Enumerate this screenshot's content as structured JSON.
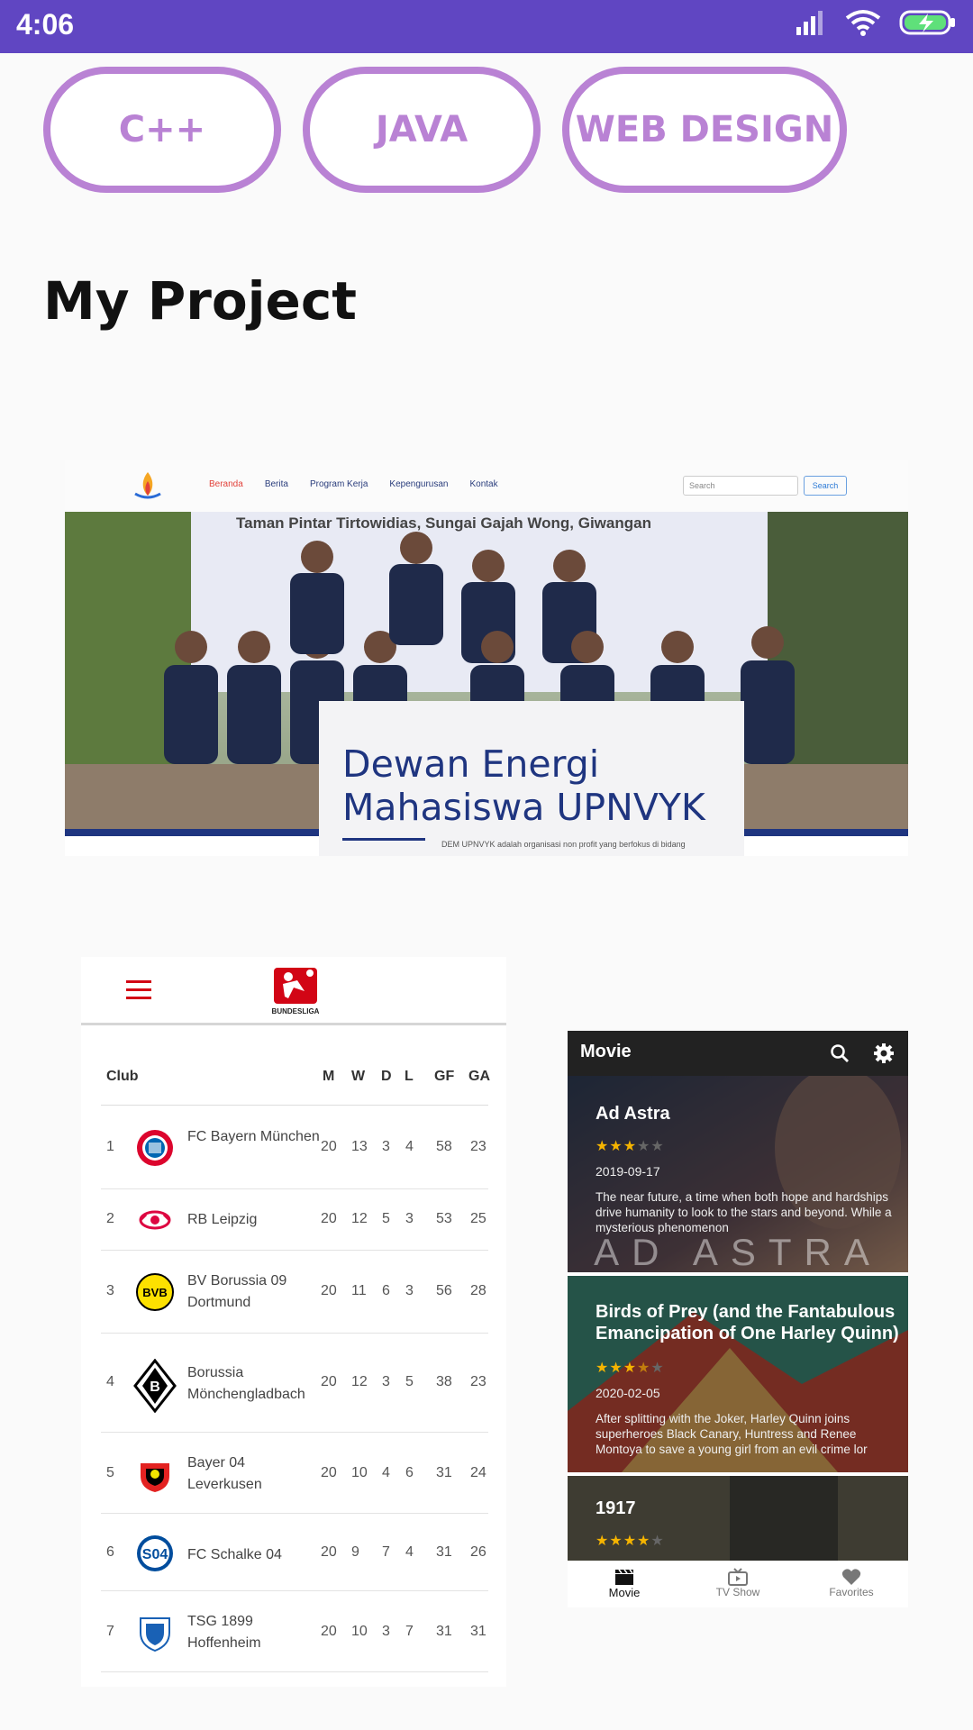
{
  "status_bar": {
    "time": "4:06"
  },
  "skills": [
    "C++",
    "JAVA",
    "WEB DESIGN"
  ],
  "section_title": "My Project",
  "website_project": {
    "nav_links": [
      "Beranda",
      "Berita",
      "Program Kerja",
      "Kepengurusan",
      "Kontak"
    ],
    "search_placeholder": "Search",
    "search_button": "Search",
    "banner_text": "Taman Pintar Tirtowidias, Sungai Gajah Wong, Giwangan",
    "card_title": "Dewan Energi Mahasiswa UPNVYK",
    "card_desc": "DEM UPNVYK adalah organisasi non profit yang berfokus di bidang"
  },
  "bundesliga_project": {
    "logo_text": "BUNDESLIGA",
    "headers": [
      "Club",
      "M",
      "W",
      "D",
      "L",
      "GF",
      "GA"
    ],
    "rows": [
      {
        "rank": "1",
        "club": "FC Bayern München",
        "m": "20",
        "w": "13",
        "d": "3",
        "l": "4",
        "gf": "58",
        "ga": "23"
      },
      {
        "rank": "2",
        "club": "RB Leipzig",
        "m": "20",
        "w": "12",
        "d": "5",
        "l": "3",
        "gf": "53",
        "ga": "25"
      },
      {
        "rank": "3",
        "club": "BV Borussia 09 Dortmund",
        "m": "20",
        "w": "11",
        "d": "6",
        "l": "3",
        "gf": "56",
        "ga": "28"
      },
      {
        "rank": "4",
        "club": "Borussia Mönchengladbach",
        "m": "20",
        "w": "12",
        "d": "3",
        "l": "5",
        "gf": "38",
        "ga": "23"
      },
      {
        "rank": "5",
        "club": "Bayer 04 Leverkusen",
        "m": "20",
        "w": "10",
        "d": "4",
        "l": "6",
        "gf": "31",
        "ga": "24"
      },
      {
        "rank": "6",
        "club": "FC Schalke 04",
        "m": "20",
        "w": "9",
        "d": "7",
        "l": "4",
        "gf": "31",
        "ga": "26"
      },
      {
        "rank": "7",
        "club": "TSG 1899 Hoffenheim",
        "m": "20",
        "w": "10",
        "d": "3",
        "l": "7",
        "gf": "31",
        "ga": "31"
      }
    ]
  },
  "movie_project": {
    "app_title": "Movie",
    "movies": [
      {
        "title": "Ad Astra",
        "rating_stars": 3,
        "date": "2019-09-17",
        "desc": "The near future, a time when both hope and hardships drive humanity to look to the stars and beyond. While a mysterious phenomenon",
        "bg_text": "AD ASTRA"
      },
      {
        "title": "Birds of Prey (and the Fantabulous Emancipation of One Harley Quinn)",
        "rating_stars": 3.5,
        "date": "2020-02-05",
        "desc": "After splitting with the Joker, Harley Quinn joins superheroes Black Canary, Huntress and Renee Montoya to save a young girl from an evil crime lor"
      },
      {
        "title": "1917",
        "rating_stars": 4
      }
    ],
    "nav": [
      "Movie",
      "TV Show",
      "Favorites"
    ]
  },
  "colors": {
    "status_bar": "#6046c2",
    "pill_accent": "#b982d4",
    "bundesliga_red": "#d20515",
    "dem_blue": "#1f3580"
  }
}
